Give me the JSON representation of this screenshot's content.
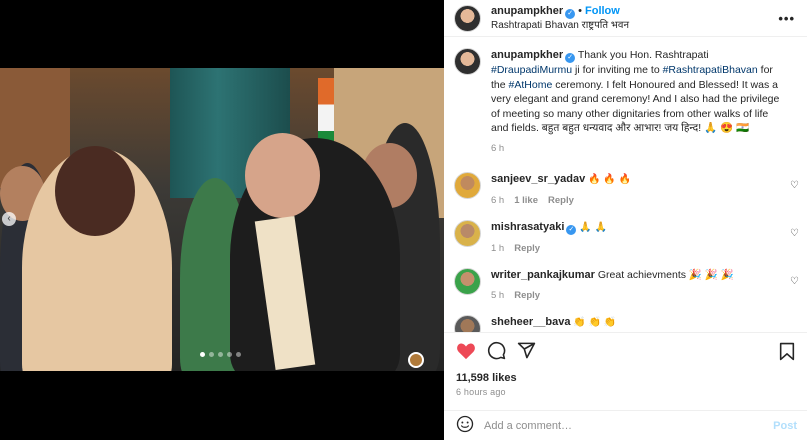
{
  "post": {
    "username": "anupampkher",
    "follow_label": "Follow",
    "separator": "•",
    "location": "Rashtrapati Bhavan राष्ट्रपति भवन",
    "more_label": "•••",
    "carousel": {
      "total_slides": 5,
      "active_slide": 1
    }
  },
  "caption": {
    "username": "anupampkher",
    "text_1": "Thank you Hon. Rashtrapati ",
    "tag_1": "#DraupadiMurmu",
    "text_2": " ji for inviting me to ",
    "tag_2": "#RashtrapatiBhavan",
    "text_3": " for the ",
    "tag_3": "#AtHome",
    "text_4": " ceremony. I felt Honoured and Blessed! It was a very elegant and grand ceremony! And I also had the privilege of meeting so many other dignitaries from other walks of life and fields. बहुत बहुत धन्यवाद और आभार! जय हिन्द! 🙏 😍 🇮🇳",
    "time": "6 h"
  },
  "comments": [
    {
      "username": "sanjeev_sr_yadav",
      "text": "🔥 🔥 🔥",
      "time": "6 h",
      "likes": "1 like",
      "reply": "Reply",
      "verified": false
    },
    {
      "username": "mishrasatyaki",
      "text": "🙏 🙏",
      "time": "1 h",
      "likes": "",
      "reply": "Reply",
      "verified": true
    },
    {
      "username": "writer_pankajkumar",
      "text": "Great achievments 🎉 🎉 🎉",
      "time": "5 h",
      "likes": "",
      "reply": "Reply",
      "verified": false
    },
    {
      "username": "sheheer__bava",
      "text": "👏 👏 👏",
      "time": "",
      "likes": "",
      "reply": "",
      "verified": false
    }
  ],
  "stats": {
    "likes": "11,598 likes",
    "time_ago": "6 hours ago"
  },
  "composer": {
    "placeholder": "Add a comment…",
    "post_label": "Post"
  },
  "icons": {
    "like": "heart-icon",
    "comment": "comment-bubble-icon",
    "share": "paper-plane-icon",
    "save": "bookmark-icon",
    "emoji": "smiley-icon",
    "verified": "verified-badge-icon",
    "comment_like": "small-heart-icon"
  },
  "colors": {
    "like_active": "#ed4956",
    "link": "#0095f6",
    "hashtag": "#00376b",
    "muted": "#8e8e8e",
    "post_disabled": "#b2dffc"
  }
}
